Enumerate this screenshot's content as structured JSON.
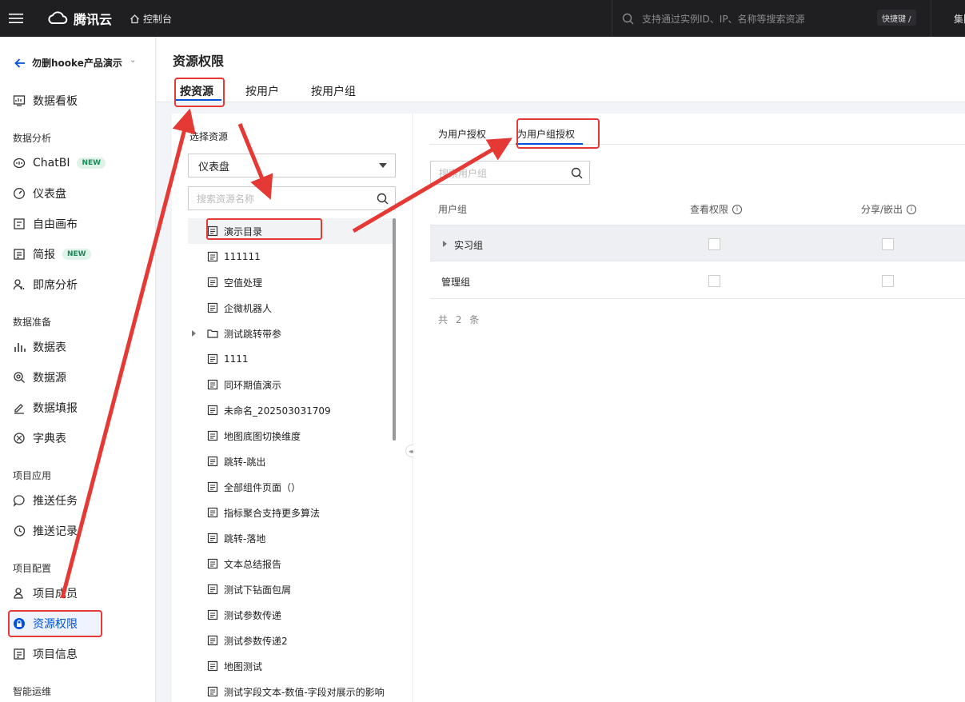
{
  "topbar": {
    "brand": "腾讯云",
    "console_label": "控制台",
    "search_placeholder": "支持通过实例ID、IP、名称等搜索资源",
    "shortcut_label": "快捷键 /",
    "group_label": "集团"
  },
  "sidebar": {
    "project_name": "勿删hooke产品演示",
    "items": [
      {
        "label": "数据看板",
        "icon": "dashboard-board-icon"
      },
      {
        "label": "ChatBI",
        "icon": "chat-icon",
        "badge": "NEW"
      },
      {
        "label": "仪表盘",
        "icon": "gauge-icon"
      },
      {
        "label": "自由画布",
        "icon": "canvas-icon"
      },
      {
        "label": "简报",
        "icon": "report-icon",
        "badge": "NEW"
      },
      {
        "label": "即席分析",
        "icon": "adhoc-icon"
      },
      {
        "label": "数据表",
        "icon": "bar-icon"
      },
      {
        "label": "数据源",
        "icon": "datasource-icon"
      },
      {
        "label": "数据填报",
        "icon": "pen-icon"
      },
      {
        "label": "字典表",
        "icon": "dictionary-icon"
      },
      {
        "label": "推送任务",
        "icon": "message-icon"
      },
      {
        "label": "推送记录",
        "icon": "history-icon"
      },
      {
        "label": "项目成员",
        "icon": "member-icon"
      },
      {
        "label": "资源权限",
        "icon": "lock-icon"
      },
      {
        "label": "项目信息",
        "icon": "info-doc-icon"
      }
    ],
    "sections": [
      "数据分析",
      "数据准备",
      "项目应用",
      "项目配置",
      "智能运维"
    ]
  },
  "main": {
    "title": "资源权限",
    "tabs": [
      "按资源",
      "按用户",
      "按用户组"
    ]
  },
  "left_panel": {
    "title": "选择资源",
    "select_value": "仪表盘",
    "search_placeholder": "搜索资源名称",
    "tree": [
      {
        "label": "演示目录",
        "type": "doc"
      },
      {
        "label": "111111",
        "type": "doc"
      },
      {
        "label": "空值处理",
        "type": "doc"
      },
      {
        "label": "企微机器人",
        "type": "doc"
      },
      {
        "label": "测试跳转带参",
        "type": "folder"
      },
      {
        "label": "1111",
        "type": "doc"
      },
      {
        "label": "同环期值演示",
        "type": "doc"
      },
      {
        "label": "未命名_202503031709",
        "type": "doc"
      },
      {
        "label": "地图底图切换维度",
        "type": "doc"
      },
      {
        "label": "跳转-跳出",
        "type": "doc"
      },
      {
        "label": "全部组件页面（）",
        "type": "doc"
      },
      {
        "label": "指标聚合支持更多算法",
        "type": "doc"
      },
      {
        "label": "跳转-落地",
        "type": "doc"
      },
      {
        "label": "文本总结报告",
        "type": "doc"
      },
      {
        "label": "测试下钻面包屑",
        "type": "doc"
      },
      {
        "label": "测试参数传递",
        "type": "doc"
      },
      {
        "label": "测试参数传递2",
        "type": "doc"
      },
      {
        "label": "地图测试",
        "type": "doc"
      },
      {
        "label": "测试字段文本-数值-字段对展示的影响",
        "type": "doc"
      }
    ]
  },
  "right_panel": {
    "subtabs": [
      "为用户授权",
      "为用户组授权"
    ],
    "search_placeholder": "搜索用户组",
    "columns": [
      "用户组",
      "查看权限",
      "分享/嵌出"
    ],
    "rows": [
      {
        "name": "实习组",
        "view": false,
        "share": false
      },
      {
        "name": "管理组",
        "view": false,
        "share": false
      }
    ],
    "total": "共 2 条"
  },
  "colors": {
    "accent": "#0052d9",
    "annotation": "#e53935",
    "topbar": "#1f1f22"
  }
}
